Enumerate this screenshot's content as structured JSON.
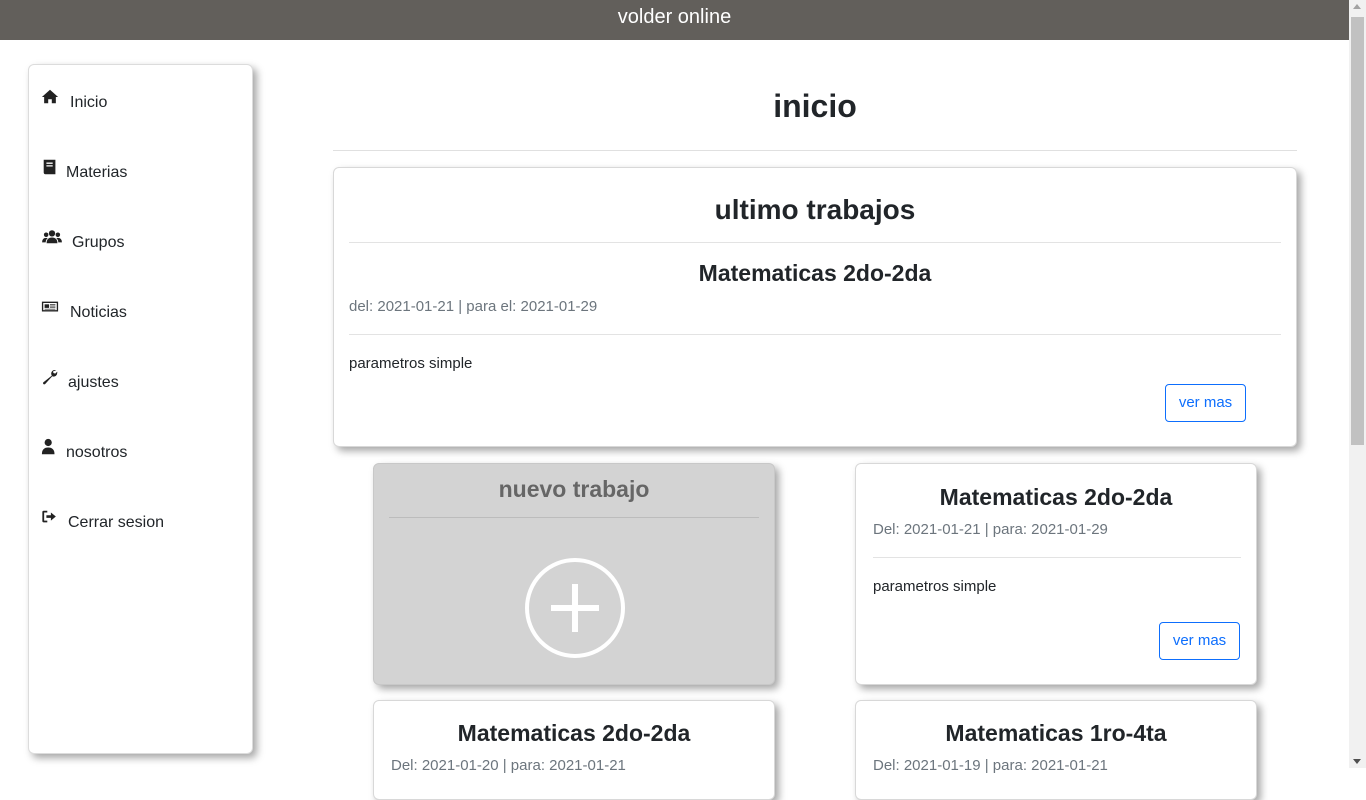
{
  "header": {
    "title": "volder online"
  },
  "sidebar": {
    "items": [
      {
        "label": "Inicio",
        "icon": "home-icon"
      },
      {
        "label": "Materias",
        "icon": "book-icon"
      },
      {
        "label": "Grupos",
        "icon": "users-icon"
      },
      {
        "label": "Noticias",
        "icon": "newspaper-icon"
      },
      {
        "label": "ajustes",
        "icon": "wrench-icon"
      },
      {
        "label": "nosotros",
        "icon": "user-icon"
      },
      {
        "label": "Cerrar sesion",
        "icon": "sign-out-icon"
      }
    ]
  },
  "main": {
    "title": "inicio",
    "latest": {
      "section_title": "ultimo trabajos",
      "title": "Matematicas 2do-2da",
      "dates": "del: 2021-01-21 | para el: 2021-01-29",
      "description": "parametros simple",
      "button": "ver mas"
    },
    "new_work": {
      "title": "nuevo trabajo",
      "icon": "plus-circle-icon"
    },
    "works": [
      {
        "title": "Matematicas 2do-2da",
        "dates": "Del: 2021-01-21 | para: 2021-01-29",
        "description": "parametros simple",
        "button": "ver mas"
      },
      {
        "title": "Matematicas 2do-2da",
        "dates": "Del: 2021-01-20 | para: 2021-01-21"
      },
      {
        "title": "Matematicas 1ro-4ta",
        "dates": "Del: 2021-01-19 | para: 2021-01-21"
      }
    ]
  },
  "colors": {
    "topbar": "#625f5b",
    "accent": "#0d6efd",
    "new_card": "#d3d3d3"
  }
}
